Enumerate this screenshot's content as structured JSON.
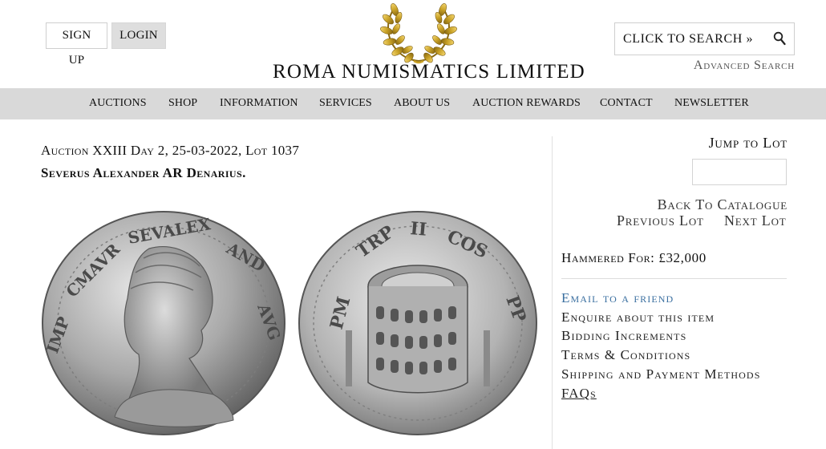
{
  "header": {
    "signup_label": "SIGN UP",
    "login_label": "LOGIN",
    "logo_text": "ROMA NUMISMATICS LIMITED",
    "search_label": "CLICK TO SEARCH »",
    "advanced_search_label": "Advanced Search"
  },
  "nav": {
    "items": [
      "AUCTIONS",
      "SHOP",
      "INFORMATION",
      "SERVICES",
      "ABOUT US",
      "AUCTION REWARDS",
      "CONTACT",
      "NEWSLETTER"
    ]
  },
  "lot": {
    "title": "Auction XXIII Day 2, 25-03-2022, Lot 1037",
    "name": "Severus Alexander AR Denarius."
  },
  "sidebar": {
    "jump_label": "Jump to Lot",
    "jump_value": "",
    "back_label": "Back To Catalogue",
    "prev_label": "Previous Lot",
    "next_label": "Next Lot",
    "hammered_label": "Hammered For: £32,000",
    "links": [
      "Email to a friend",
      "Enquire about this item",
      "Bidding Increments",
      "Terms & Conditions",
      "Shipping and Payment Methods",
      "FAQs"
    ]
  },
  "colors": {
    "nav_bg": "#d9d9d9",
    "link_blue": "#3a6fa0",
    "gold": "#c9a227"
  },
  "icons": {
    "search": "search-icon",
    "wreath": "laurel-wreath-icon"
  }
}
